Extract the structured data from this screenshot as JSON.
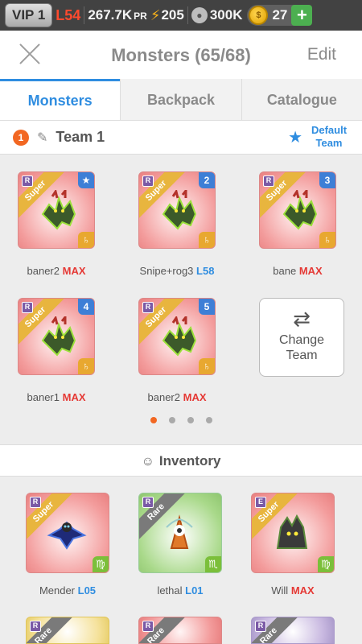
{
  "status": {
    "vip": "VIP 1",
    "level": "L54",
    "power": "267.7K",
    "power_unit": "PR",
    "energy": "205",
    "food": "300K",
    "gold": "27"
  },
  "header": {
    "title": "Monsters (65/68)",
    "edit_label": "Edit"
  },
  "tabs": [
    "Monsters",
    "Backpack",
    "Catalogue"
  ],
  "team": {
    "number": "1",
    "name": "Team 1",
    "default_label": "Default\nTeam"
  },
  "team_monsters": [
    {
      "rarity": "Super",
      "slot": "★",
      "name": "baner2",
      "level": "MAX",
      "level_type": "max"
    },
    {
      "rarity": "Super",
      "slot": "2",
      "name": "Snipe+rog3",
      "level": "L58",
      "level_type": "lvl"
    },
    {
      "rarity": "Super",
      "slot": "3",
      "name": "bane",
      "level": "MAX",
      "level_type": "max"
    },
    {
      "rarity": "Super",
      "slot": "4",
      "name": "baner1",
      "level": "MAX",
      "level_type": "max"
    },
    {
      "rarity": "Super",
      "slot": "5",
      "name": "baner2",
      "level": "MAX",
      "level_type": "max"
    }
  ],
  "change_team_label": "Change\nTeam",
  "inventory_title": "Inventory",
  "inventory": [
    {
      "rarity": "Super",
      "name": "Mender",
      "level": "L05",
      "level_type": "lvl"
    },
    {
      "rarity": "Rare",
      "name": "lethal",
      "level": "L01",
      "level_type": "lvl"
    },
    {
      "rarity": "Super",
      "name": "Will",
      "level": "MAX",
      "level_type": "max"
    }
  ],
  "inventory_row2": [
    "Rare",
    "Rare",
    "Rare"
  ]
}
